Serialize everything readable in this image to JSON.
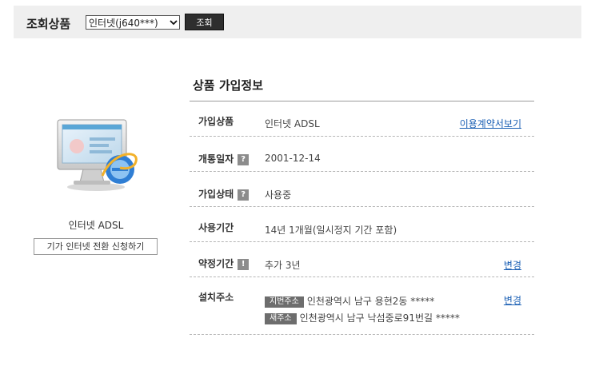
{
  "header": {
    "label": "조회상품",
    "select_value": "인터넷(j640***)",
    "search_button": "조회"
  },
  "product": {
    "name": "인터넷 ADSL",
    "switch_button": "기가 인터넷 전환 신청하기",
    "image_icon": "computer-with-ie-logo-icon"
  },
  "section": {
    "title": "상품 가입정보"
  },
  "rows": {
    "product": {
      "key": "가입상품",
      "value": "인터넷 ADSL",
      "link": "이용계약서보기"
    },
    "open_date": {
      "key": "개통일자",
      "help": "?",
      "value": "2001-12-14"
    },
    "status": {
      "key": "가입상태",
      "help": "?",
      "value": "사용중"
    },
    "usage_period": {
      "key": "사용기간",
      "value": "14년 1개월(일시정지 기간 포함)"
    },
    "contract": {
      "key": "약정기간",
      "help": "!",
      "value": "추가 3년",
      "link": "변경"
    },
    "address": {
      "key": "설치주소",
      "lot_tag": "지번주소",
      "lot_value": "인천광역시 남구 용현2동 *****",
      "road_tag": "새주소",
      "road_value": "인천광역시 남구 낙섬중로91번길 *****",
      "link": "변경"
    }
  }
}
